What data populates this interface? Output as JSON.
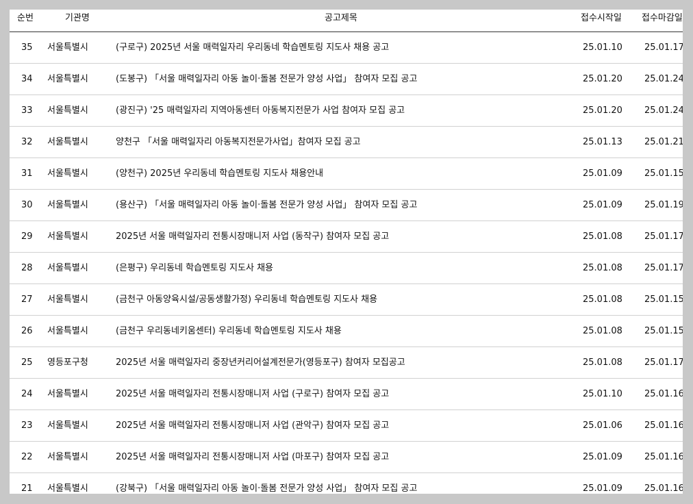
{
  "table": {
    "headers": {
      "num": "순번",
      "org": "기관명",
      "title": "공고제목",
      "start": "접수시작일",
      "end": "접수마감일"
    },
    "rows": [
      {
        "num": "35",
        "org": "서울특별시",
        "title": "(구로구) 2025년 서울 매력일자리 우리동네 학습멘토링 지도사 채용 공고",
        "start": "25.01.10",
        "end": "25.01.17"
      },
      {
        "num": "34",
        "org": "서울특별시",
        "title": "(도봉구) 「서울 매력일자리 아동 놀이·돌봄 전문가 양성 사업」 참여자 모집 공고",
        "start": "25.01.20",
        "end": "25.01.24"
      },
      {
        "num": "33",
        "org": "서울특별시",
        "title": "(광진구) '25 매력일자리 지역아동센터 아동복지전문가 사업 참여자 모집 공고",
        "start": "25.01.20",
        "end": "25.01.24"
      },
      {
        "num": "32",
        "org": "서울특별시",
        "title": "양천구 「서울 매력일자리 아동복지전문가사업」참여자 모집 공고",
        "start": "25.01.13",
        "end": "25.01.21"
      },
      {
        "num": "31",
        "org": "서울특별시",
        "title": "(양천구) 2025년 우리동네 학습멘토링 지도사 채용안내",
        "start": "25.01.09",
        "end": "25.01.15"
      },
      {
        "num": "30",
        "org": "서울특별시",
        "title": "(용산구) 「서울 매력일자리 아동 놀이·돌봄 전문가 양성 사업」 참여자 모집 공고",
        "start": "25.01.09",
        "end": "25.01.19"
      },
      {
        "num": "29",
        "org": "서울특별시",
        "title": "2025년 서울 매력일자리 전통시장매니저 사업 (동작구) 참여자 모집 공고",
        "start": "25.01.08",
        "end": "25.01.17"
      },
      {
        "num": "28",
        "org": "서울특별시",
        "title": "(은평구) 우리동네 학습멘토링 지도사 채용",
        "start": "25.01.08",
        "end": "25.01.17"
      },
      {
        "num": "27",
        "org": "서울특별시",
        "title": "(금천구 아동양육시설/공동생활가정) 우리동네 학습멘토링 지도사 채용",
        "start": "25.01.08",
        "end": "25.01.15"
      },
      {
        "num": "26",
        "org": "서울특별시",
        "title": "(금천구 우리동네키움센터) 우리동네 학습멘토링 지도사 채용",
        "start": "25.01.08",
        "end": "25.01.15"
      },
      {
        "num": "25",
        "org": "영등포구청",
        "title": "2025년 서울 매력일자리 중장년커리어설계전문가(영등포구) 참여자 모집공고",
        "start": "25.01.08",
        "end": "25.01.17"
      },
      {
        "num": "24",
        "org": "서울특별시",
        "title": "2025년 서울 매력일자리 전통시장매니저 사업 (구로구) 참여자 모집 공고",
        "start": "25.01.10",
        "end": "25.01.16"
      },
      {
        "num": "23",
        "org": "서울특별시",
        "title": "2025년 서울 매력일자리 전통시장매니저 사업 (관악구) 참여자 모집 공고",
        "start": "25.01.06",
        "end": "25.01.16"
      },
      {
        "num": "22",
        "org": "서울특별시",
        "title": "2025년 서울 매력일자리 전통시장매니저 사업 (마포구) 참여자 모집 공고",
        "start": "25.01.09",
        "end": "25.01.16"
      },
      {
        "num": "21",
        "org": "서울특별시",
        "title": "(강북구) 「서울 매력일자리 아동 놀이·돌봄 전문가 양성 사업」 참여자 모집 공고",
        "start": "25.01.09",
        "end": "25.01.16"
      }
    ]
  }
}
